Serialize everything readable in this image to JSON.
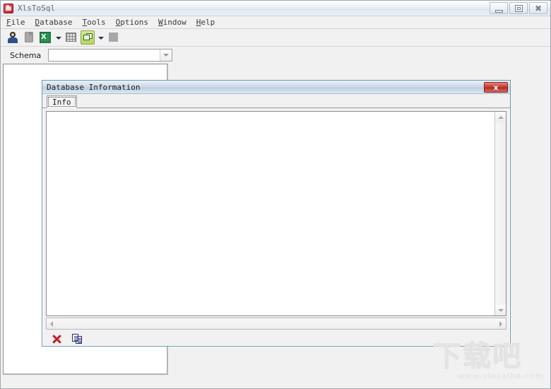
{
  "window": {
    "title": "XlsToSql",
    "icon": "app-logo-icon",
    "controls": {
      "minimize_label": "Minimize",
      "maximize_label": "Maximize",
      "close_label": "Close"
    }
  },
  "menu": {
    "items": [
      {
        "label": "File",
        "accel": "F",
        "rest": "ile"
      },
      {
        "label": "Database",
        "accel": "D",
        "rest": "atabase"
      },
      {
        "label": "Tools",
        "accel": "T",
        "rest": "ools"
      },
      {
        "label": "Options",
        "accel": "O",
        "rest": "ptions"
      },
      {
        "label": "Window",
        "accel": "W",
        "rest": "indow"
      },
      {
        "label": "Help",
        "accel": "H",
        "rest": "elp"
      }
    ]
  },
  "toolbar": {
    "buttons": [
      {
        "name": "connect-user-icon",
        "tooltip": "Connect"
      },
      {
        "name": "disconnect-db-icon",
        "tooltip": "Disconnect"
      },
      {
        "name": "excel-sheet-icon",
        "tooltip": "Open Excel File"
      },
      {
        "name": "excel-dropdown-icon",
        "tooltip": "Excel options"
      },
      {
        "name": "table-grid-icon",
        "tooltip": "Tables"
      },
      {
        "name": "green-window-icon",
        "tooltip": "Database Information"
      },
      {
        "name": "window-dropdown-icon",
        "tooltip": "Window options"
      },
      {
        "name": "stop-square-icon",
        "tooltip": "Stop"
      }
    ]
  },
  "schema": {
    "label": "Schema",
    "value": "",
    "placeholder": "",
    "dropdown_icon": "chevron-down-icon"
  },
  "dialog": {
    "title": "Database Information",
    "close_label": "x",
    "tabs": [
      {
        "label": "Info",
        "active": true
      }
    ],
    "info_text": "",
    "buttons": [
      {
        "name": "close-dialog-icon",
        "label": "Close"
      },
      {
        "name": "copy-icon",
        "label": "Copy"
      }
    ],
    "scrollbars": {
      "vertical_up_icon": "triangle-up-icon",
      "vertical_down_icon": "triangle-down-icon",
      "horizontal_left_icon": "triangle-left-icon",
      "horizontal_right_icon": "triangle-right-icon"
    }
  },
  "watermark": {
    "text": "下载吧",
    "url": "www.xiazaiba.com"
  },
  "colors": {
    "titlebar_start": "#fdfdfe",
    "titlebar_end": "#eaf0f6",
    "dialog_border": "#6f9aa8",
    "dialog_close_red": "#cc4b42",
    "excel_green": "#2ea05a",
    "toolbar_active_green": "#b6d463",
    "panel_white": "#ffffff",
    "app_background": "#f1f1f1"
  }
}
